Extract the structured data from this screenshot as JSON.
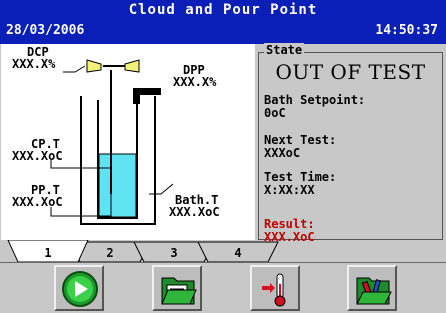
{
  "header": {
    "title": "Cloud and Pour Point",
    "date": "28/03/2006",
    "time": "14:50:37"
  },
  "diagram": {
    "dcp_label": "DCP",
    "dcp_value": "XXX.X%",
    "dpp_label": "DPP",
    "dpp_value": "XXX.X%",
    "cpt_label": "CP.T",
    "cpt_value": "XXX.XoC",
    "ppt_label": "PP.T",
    "ppt_value": "XXX.XoC",
    "batht_label": "Bath.T",
    "batht_value": "XXX.XoC",
    "colors": {
      "liquid": "#5fe3f2",
      "sensor_yellow": "#f2f27a"
    }
  },
  "state": {
    "title": "State",
    "status": "OUT OF TEST",
    "bath_setpoint_label": "Bath Setpoint:",
    "bath_setpoint_value": "0oC",
    "next_test_label": "Next Test:",
    "next_test_value": "XXXoC",
    "test_time_label": "Test Time:",
    "test_time_value": "X:XX:XX",
    "result_label": "Result:",
    "result_value": "XXX.XoC",
    "result_color": "#c00000"
  },
  "tabs": [
    "1",
    "2",
    "3",
    "4"
  ],
  "active_tab": "1",
  "toolbar": {
    "buttons": [
      {
        "icon": "play-icon"
      },
      {
        "icon": "folder-document-icon"
      },
      {
        "icon": "thermometer-icon"
      },
      {
        "icon": "folder-tools-icon"
      }
    ]
  }
}
